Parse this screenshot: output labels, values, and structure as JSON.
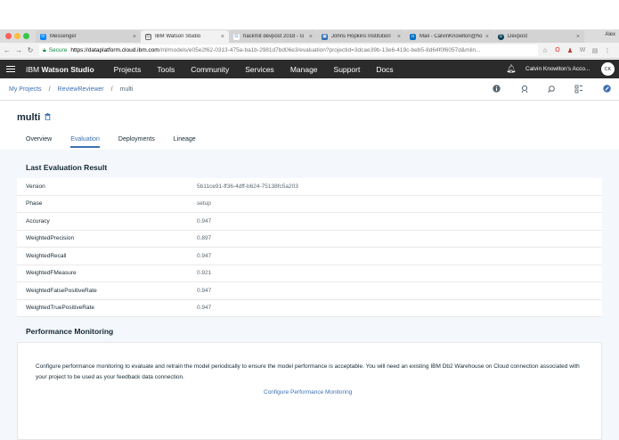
{
  "browser": {
    "tabs": [
      {
        "title": "Messenger",
        "icon": "messenger-icon",
        "color": "#0084ff"
      },
      {
        "title": "IBM Watson Studio",
        "icon": "watson-icon",
        "color": "#444444"
      },
      {
        "title": "hackmit devpost 2018 - G",
        "icon": "google-icon",
        "color": "#4285f4"
      },
      {
        "title": "Johns Hopkins Institution",
        "icon": "jhu-icon",
        "color": "#2f6db5"
      },
      {
        "title": "Mail - CalvinKnowlton@ho",
        "icon": "outlook-icon",
        "color": "#0072c6"
      },
      {
        "title": "Devpost",
        "icon": "devpost-icon",
        "color": "#003e54"
      }
    ],
    "profile_name": "Alex",
    "secure_label": "Secure",
    "url_host": "https://dataplatform.cloud.ibm.com",
    "url_path": "/ml/models/e05e2f62-0313-475a-ba1b-2981d7bd06e3/evaluation?projectid=3dcae39b-13e6-419c-beb5-8d64f0f6057d&mlin..."
  },
  "header": {
    "brand_prefix": "IBM ",
    "brand_name": "Watson Studio",
    "nav": [
      "Projects",
      "Tools",
      "Community",
      "Services",
      "Manage",
      "Support",
      "Docs"
    ],
    "account": "Calvin Knowlton's Acco...",
    "avatar_initials": "CK"
  },
  "breadcrumb": {
    "items": [
      "My Projects",
      "ReviewReviewer"
    ],
    "current": "multi",
    "separator": "/"
  },
  "model": {
    "title": "multi",
    "tabs": [
      "Overview",
      "Evaluation",
      "Deployments",
      "Lineage"
    ],
    "active_tab": "Evaluation"
  },
  "evaluation": {
    "title": "Last Evaluation Result",
    "rows": [
      {
        "key": "Version",
        "value": "5b11ce91-ff36-4dff-b624-75138fc5a203"
      },
      {
        "key": "Phase",
        "value": "setup"
      },
      {
        "key": "Accuracy",
        "value": "0.947"
      },
      {
        "key": "WeightedPrecision",
        "value": "0.897"
      },
      {
        "key": "WeightedRecall",
        "value": "0.947"
      },
      {
        "key": "WeightedFMeasure",
        "value": "0.921"
      },
      {
        "key": "WeightedFalsePositiveRate",
        "value": "0.947"
      },
      {
        "key": "WeightedTruePositiveRate",
        "value": "0.947"
      }
    ]
  },
  "performance": {
    "title": "Performance Monitoring",
    "description": "Configure performance monitoring to evaluate and retrain the model periodically to ensure the model performance is acceptable. You will need an existing IBM Db2 Warehouse on Cloud connection associated with your project to be used as your feedback data connection.",
    "link": "Configure Performance Monitoring"
  },
  "colors": {
    "accent": "#3d70b2",
    "header_bg": "#2b2b2b",
    "page_bg": "#f4f7fb"
  }
}
